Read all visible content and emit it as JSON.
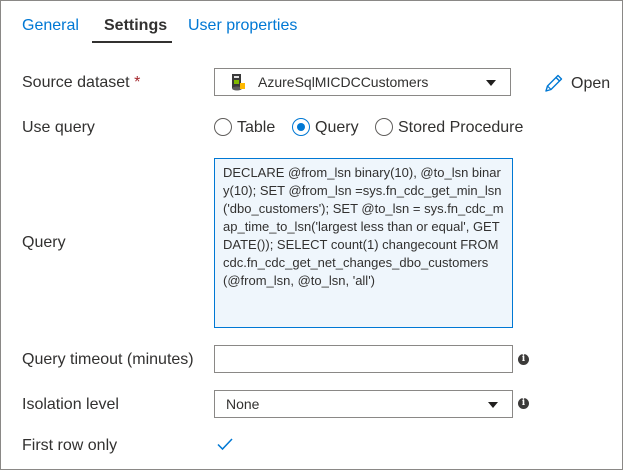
{
  "tabs": [
    {
      "label": "General"
    },
    {
      "label": "Settings"
    },
    {
      "label": "User properties"
    }
  ],
  "active_tab": "Settings",
  "source_dataset": {
    "label": "Source dataset",
    "required_marker": "*",
    "value": "AzureSqlMICDCCustomers",
    "icon": "sql-dataset-icon",
    "open_label": "Open"
  },
  "use_query": {
    "label": "Use query",
    "options": [
      {
        "label": "Table",
        "selected": false
      },
      {
        "label": "Query",
        "selected": true
      },
      {
        "label": "Stored Procedure",
        "selected": false
      }
    ]
  },
  "query": {
    "label": "Query",
    "text": "DECLARE @from_lsn binary(10), @to_lsn binary(10); SET @from_lsn =sys.fn_cdc_get_min_lsn('dbo_customers'); SET @to_lsn = sys.fn_cdc_map_time_to_lsn('largest less than or equal', GETDATE()); SELECT count(1) changecount FROM cdc.fn_cdc_get_net_changes_dbo_customers(@from_lsn, @to_lsn, 'all')"
  },
  "query_timeout": {
    "label": "Query timeout (minutes)",
    "value": ""
  },
  "isolation_level": {
    "label": "Isolation level",
    "value": "None"
  },
  "first_row_only": {
    "label": "First row only",
    "checked": true
  },
  "colors": {
    "accent": "#0078d4",
    "required": "#a4262c",
    "text": "#323130"
  }
}
